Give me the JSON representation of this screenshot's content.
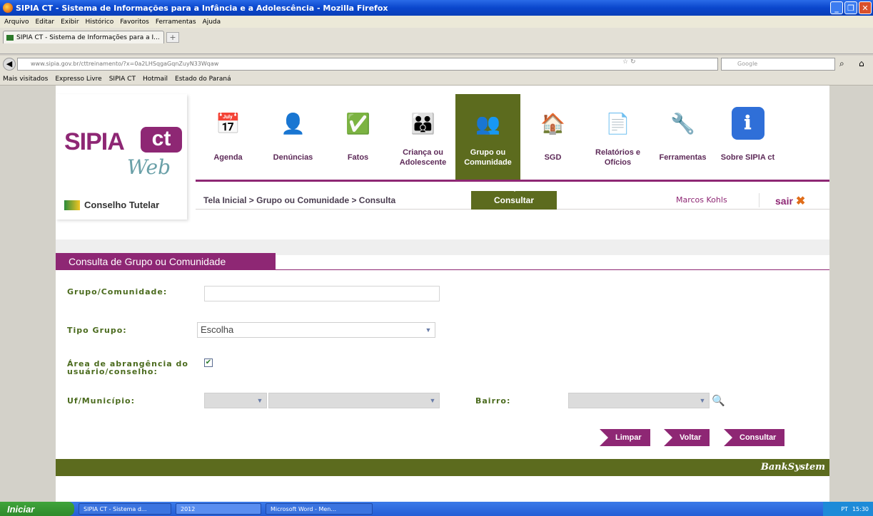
{
  "browser": {
    "window_title": "SIPIA CT - Sistema de Informações para a Infância e a Adolescência - Mozilla Firefox",
    "menu": [
      "Arquivo",
      "Editar",
      "Exibir",
      "Histórico",
      "Favoritos",
      "Ferramentas",
      "Ajuda"
    ],
    "tab_title": "SIPIA CT - Sistema de Informações para a I...",
    "url": "www.sipia.gov.br/cttreinamento/?x=0a2LHSqgaGqnZuyN33Wqaw",
    "search_placeholder": "Google",
    "bookmarks": [
      "Mais visitados",
      "Expresso Livre",
      "SIPIA CT",
      "Hotmail",
      "Estado do Paraná"
    ]
  },
  "site": {
    "logo_main": "SIPIA",
    "logo_ct": "ct",
    "logo_web": "Web",
    "conselho": "Conselho Tutelar",
    "menu": [
      {
        "label": "Agenda",
        "icon": "calendar-icon",
        "glyph": "📅"
      },
      {
        "label": "Denúncias",
        "icon": "person-desk-icon",
        "glyph": "👤"
      },
      {
        "label": "Fatos",
        "icon": "person-check-icon",
        "glyph": "✅"
      },
      {
        "label": "Criança ou Adolescente",
        "icon": "children-icon",
        "glyph": "👪"
      },
      {
        "label": "Grupo ou Comunidade",
        "icon": "group-icon",
        "glyph": "👥"
      },
      {
        "label": "SGD",
        "icon": "house-icon",
        "glyph": "🏠"
      },
      {
        "label": "Relatórios e Ofícios",
        "icon": "documents-icon",
        "glyph": "📄"
      },
      {
        "label": "Ferramentas",
        "icon": "tools-icon",
        "glyph": "🔧"
      },
      {
        "label": "Sobre SIPIA ct",
        "icon": "info-icon",
        "glyph": "ℹ"
      }
    ],
    "active_menu": "Grupo ou Comunidade",
    "breadcrumb": "Tela Inicial > Grupo ou Comunidade > Consulta",
    "subtab": "Consultar",
    "user": "Marcos Kohls",
    "logout": "sair",
    "footer_brand": "BankSystem"
  },
  "form": {
    "title": "Consulta de Grupo ou Comunidade",
    "grupo_label": "Grupo/Comunidade:",
    "grupo_value": "",
    "tipo_label": "Tipo Grupo:",
    "tipo_value": "Escolha",
    "area_label_1": "Área de abrangência do",
    "area_label_2": "usuário/conselho:",
    "area_checked": true,
    "uf_label": "Uf/Município:",
    "bairro_label": "Bairro:",
    "buttons": {
      "limpar": "Limpar",
      "voltar": "Voltar",
      "consultar": "Consultar"
    }
  },
  "taskbar": {
    "start": "Iniciar",
    "items": [
      "SIPIA CT - Sistema d...",
      "2012",
      "Microsoft Word - Men..."
    ],
    "lang": "PT",
    "time": "15:30"
  },
  "colors": {
    "brand_purple": "#8e2774",
    "brand_green": "#5c6b1e"
  }
}
